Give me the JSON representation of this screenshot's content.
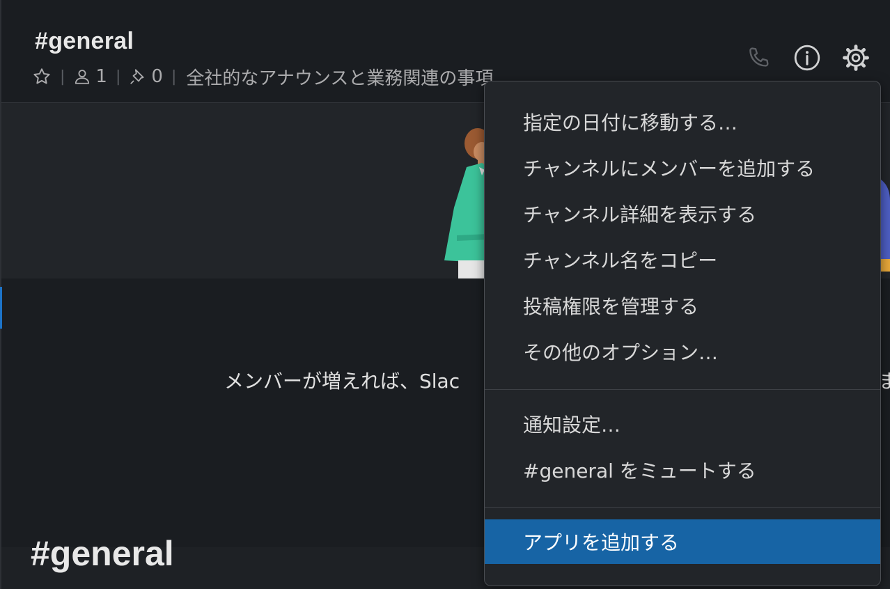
{
  "header": {
    "channel_title": "#general",
    "member_count": "1",
    "pin_count": "0",
    "topic": "全社的なアナウンスと業務関連の事項"
  },
  "main": {
    "intro_text": "メンバーが増えれば、Slac",
    "intro_tail": "ま",
    "channel_heading": "#general"
  },
  "menu": {
    "groups": [
      [
        "指定の日付に移動する…",
        "チャンネルにメンバーを追加する",
        "チャンネル詳細を表示する",
        "チャンネル名をコピー",
        "投稿権限を管理する",
        "その他のオプション…"
      ],
      [
        "通知設定…",
        "#general をミュートする"
      ],
      [
        "アプリを追加する"
      ]
    ],
    "highlighted_item": "アプリを追加する"
  },
  "icons": {
    "header": [
      "star-icon",
      "member-icon",
      "pin-icon",
      "phone-icon",
      "info-icon",
      "gear-icon"
    ]
  },
  "colors": {
    "background": "#1a1d21",
    "menu_background": "#222529",
    "highlight": "#1764a5",
    "illustration_shirt": "#3cc39a"
  }
}
